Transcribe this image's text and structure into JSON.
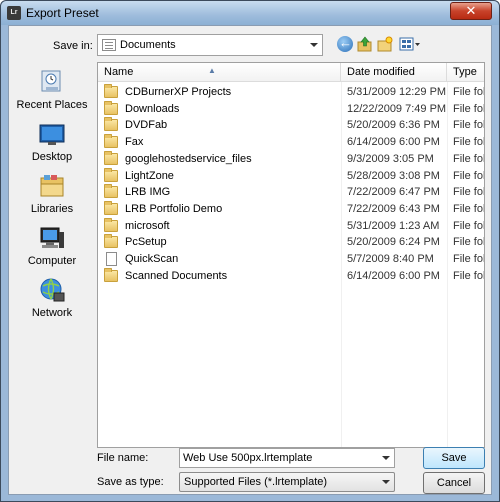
{
  "window": {
    "title": "Export Preset",
    "app_icon_text": "Lr",
    "close_glyph": "✕"
  },
  "toolbar": {
    "save_in_label": "Save in:",
    "save_in_value": "Documents",
    "icons": [
      "back-icon",
      "up-folder-icon",
      "new-folder-icon",
      "views-menu-icon"
    ]
  },
  "places": [
    {
      "label": "Recent Places",
      "icon": "recent-places-icon"
    },
    {
      "label": "Desktop",
      "icon": "desktop-icon"
    },
    {
      "label": "Libraries",
      "icon": "libraries-icon"
    },
    {
      "label": "Computer",
      "icon": "computer-icon"
    },
    {
      "label": "Network",
      "icon": "network-icon"
    }
  ],
  "filelist": {
    "columns": [
      "Name",
      "Date modified",
      "Type"
    ],
    "rows": [
      {
        "name": "CDBurnerXP Projects",
        "date": "5/31/2009 12:29 PM",
        "type": "File folder",
        "icon": "folder-icon"
      },
      {
        "name": "Downloads",
        "date": "12/22/2009 7:49 PM",
        "type": "File folder",
        "icon": "folder-icon"
      },
      {
        "name": "DVDFab",
        "date": "5/20/2009 6:36 PM",
        "type": "File folder",
        "icon": "folder-icon"
      },
      {
        "name": "Fax",
        "date": "6/14/2009 6:00 PM",
        "type": "File folder",
        "icon": "folder-icon"
      },
      {
        "name": "googlehostedservice_files",
        "date": "9/3/2009 3:05 PM",
        "type": "File folder",
        "icon": "folder-icon"
      },
      {
        "name": "LightZone",
        "date": "5/28/2009 3:08 PM",
        "type": "File folder",
        "icon": "folder-icon"
      },
      {
        "name": "LRB IMG",
        "date": "7/22/2009 6:47 PM",
        "type": "File folder",
        "icon": "folder-icon"
      },
      {
        "name": "LRB Portfolio Demo",
        "date": "7/22/2009 6:43 PM",
        "type": "File folder",
        "icon": "folder-icon"
      },
      {
        "name": "microsoft",
        "date": "5/31/2009 1:23 AM",
        "type": "File folder",
        "icon": "folder-icon"
      },
      {
        "name": "PcSetup",
        "date": "5/20/2009 6:24 PM",
        "type": "File folder",
        "icon": "folder-icon"
      },
      {
        "name": "QuickScan",
        "date": "5/7/2009 8:40 PM",
        "type": "File folder",
        "icon": "document-icon"
      },
      {
        "name": "Scanned Documents",
        "date": "6/14/2009 6:00 PM",
        "type": "File folder",
        "icon": "folder-icon"
      }
    ]
  },
  "footer": {
    "filename_label": "File name:",
    "filename_value": "Web Use 500px.lrtemplate",
    "savetype_label": "Save as type:",
    "savetype_value": "Supported Files (*.lrtemplate)",
    "save_button": "Save",
    "cancel_button": "Cancel"
  }
}
